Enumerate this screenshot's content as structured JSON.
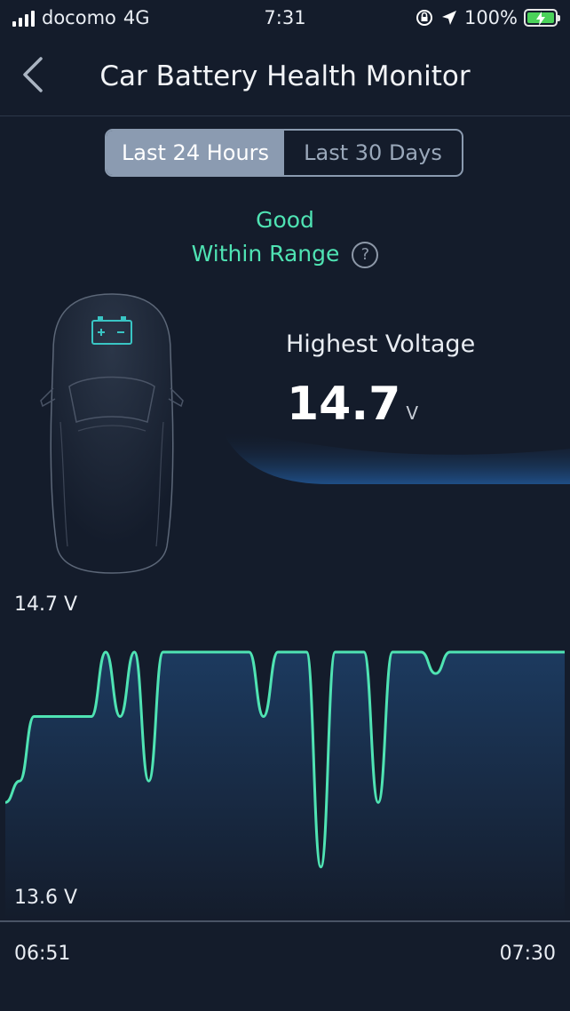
{
  "status_bar": {
    "carrier": "docomo",
    "network": "4G",
    "time": "7:31",
    "battery_pct": "100%"
  },
  "header": {
    "title": "Car Battery Health Monitor"
  },
  "tabs": [
    {
      "label": "Last 24 Hours",
      "active": true
    },
    {
      "label": "Last 30 Days",
      "active": false
    }
  ],
  "status": {
    "condition": "Good",
    "detail": "Within Range"
  },
  "highest_voltage": {
    "label": "Highest Voltage",
    "value": "14.7",
    "unit": "V"
  },
  "colors": {
    "accent": "#4fe3b3",
    "background": "#141c2b",
    "tab_active": "#8b9bb1"
  },
  "chart_data": {
    "type": "line",
    "y_top_label": "14.7 V",
    "y_bottom_label": "13.6 V",
    "x_start_label": "06:51",
    "x_end_label": "07:30",
    "ylim": [
      13.6,
      14.7
    ],
    "x": [
      "06:51",
      "06:52",
      "06:53",
      "06:54",
      "06:55",
      "06:56",
      "06:57",
      "06:58",
      "06:59",
      "07:00",
      "07:01",
      "07:02",
      "07:03",
      "07:04",
      "07:05",
      "07:06",
      "07:07",
      "07:08",
      "07:09",
      "07:10",
      "07:11",
      "07:12",
      "07:13",
      "07:14",
      "07:15",
      "07:16",
      "07:17",
      "07:18",
      "07:19",
      "07:20",
      "07:21",
      "07:22",
      "07:23",
      "07:24",
      "07:25",
      "07:26",
      "07:27",
      "07:28",
      "07:29",
      "07:30"
    ],
    "series": [
      {
        "values": [
          14.0,
          14.1,
          14.4,
          14.4,
          14.4,
          14.4,
          14.4,
          14.7,
          14.4,
          14.7,
          14.1,
          14.7,
          14.7,
          14.7,
          14.7,
          14.7,
          14.7,
          14.7,
          14.4,
          14.7,
          14.7,
          14.7,
          13.7,
          14.7,
          14.7,
          14.7,
          14.0,
          14.7,
          14.7,
          14.7,
          14.6,
          14.7,
          14.7,
          14.7,
          14.7,
          14.7,
          14.7,
          14.7,
          14.7,
          14.7
        ]
      }
    ]
  }
}
